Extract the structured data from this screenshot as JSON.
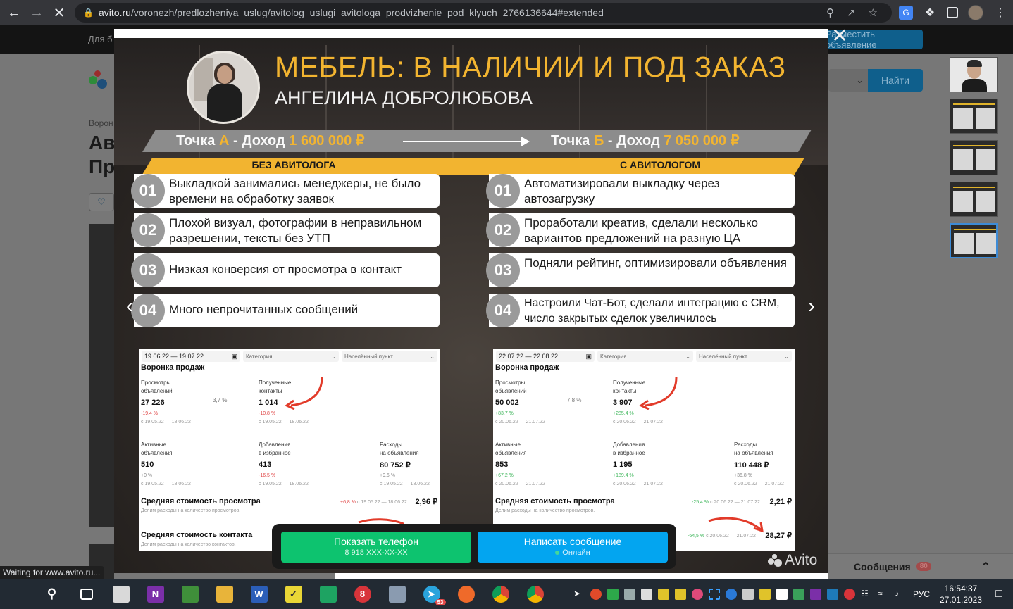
{
  "browser": {
    "url_host": "avito.ru",
    "url_path": "/voronezh/predlozheniya_uslug/avitolog_uslugi_avitologa_prodvizhenie_pod_klyuch_2766136644#extended",
    "status_text": "Waiting for www.avito.ru..."
  },
  "page_bg": {
    "topbar_hint": "Для б",
    "post_ad_label": "Разместить объявление",
    "find_label": "Найти",
    "breadcrumb": "Ворон",
    "title_line1": "Ав",
    "title_line2": "Пр",
    "messages_label": "Сообщения",
    "messages_count": "80"
  },
  "slide": {
    "headline": "МЕБЕЛЬ: В НАЛИЧИИ И ПОД ЗАКАЗ",
    "author": "АНГЕЛИНА ДОБРОЛЮБОВА",
    "point_a_label": "Точка",
    "point_a_letter": "А",
    "point_a_sep": "-  Доход",
    "point_a_income": "1 600 000 ₽",
    "point_b_label": "Точка",
    "point_b_letter": "Б",
    "point_b_sep": "-  Доход",
    "point_b_income": "7 050 000 ₽",
    "col_left_title": "БЕЗ АВИТОЛОГА",
    "col_right_title": "С АВИТОЛОГОМ",
    "left_items": [
      {
        "num": "01",
        "text": "Выкладкой занимались менеджеры, не было времени на обработку заявок"
      },
      {
        "num": "02",
        "text": "Плохой визуал, фотографии в неправильном разрешении, тексты без УТП"
      },
      {
        "num": "03",
        "text": "Низкая конверсия от просмотра в контакт"
      },
      {
        "num": "04",
        "text": "Много непрочитанных сообщений"
      }
    ],
    "right_items": [
      {
        "num": "01",
        "text": "Автоматизировали выкладку через автозагрузку"
      },
      {
        "num": "02",
        "text": "Проработали креатив, сделали несколько вариантов предложений на разную ЦА"
      },
      {
        "num": "03",
        "text": "Подняли рейтинг, оптимизировали объявления"
      },
      {
        "num": "04",
        "text": "Настроили Чат-Бот, сделали интеграцию с CRM, число закрытых сделок увеличилось"
      }
    ],
    "dash_left": {
      "date": "19.06.22 — 19.07.22",
      "category": "Категория",
      "location": "Населённый пункт",
      "title": "Воронка продаж",
      "views_label1": "Просмотры",
      "views_label2": "объявлений",
      "views": "27 226",
      "views_pct": "-19,4 %",
      "views_period": "с 19.05.22 — 18.06.22",
      "conv": "3,7 %",
      "contacts_label1": "Полученные",
      "contacts_label2": "контакты",
      "contacts": "1 014",
      "contacts_pct": "-10,8 %",
      "contacts_period": "с 19.05.22 — 18.06.22",
      "active_label1": "Активные",
      "active_label2": "объявления",
      "active": "510",
      "active_pct": "+0 %",
      "active_period": "с 19.05.22 — 18.06.22",
      "fav_label1": "Добавления",
      "fav_label2": "в избранное",
      "fav": "413",
      "fav_pct": "-16,5 %",
      "fav_period": "с 19.05.22 — 18.06.22",
      "spend_label1": "Расходы",
      "spend_label2": "на объявления",
      "spend": "80 752 ₽",
      "spend_pct": "+9,6 %",
      "spend_period": "с 19.05.22 — 18.06.22",
      "cpv_title": "Средняя стоимость просмотра",
      "cpv_sub": "Делим расходы на количество просмотров.",
      "cpv_pct": "+6,8 %",
      "cpv_period": "с 19.05.22 — 18.06.22",
      "cpv": "2,96 ₽",
      "cpc_title": "Средняя стоимость контакта",
      "cpc_sub": "Делим расходы на количество контактов."
    },
    "dash_right": {
      "date": "22.07.22 — 22.08.22",
      "category": "Категория",
      "location": "Населённый пункт",
      "title": "Воронка продаж",
      "views_label1": "Просмотры",
      "views_label2": "объявлений",
      "views": "50 002",
      "views_pct": "+83,7 %",
      "views_period": "с 20.06.22 — 21.07.22",
      "conv": "7,8 %",
      "contacts_label1": "Полученные",
      "contacts_label2": "контакты",
      "contacts": "3 907",
      "contacts_pct": "+285,4 %",
      "contacts_period": "с 20.06.22 — 21.07.22",
      "active_label1": "Активные",
      "active_label2": "объявления",
      "active": "853",
      "active_pct": "+67,2 %",
      "active_period": "с 20.06.22 — 21.07.22",
      "fav_label1": "Добавления",
      "fav_label2": "в избранное",
      "fav": "1 195",
      "fav_pct": "+189,4 %",
      "fav_period": "с 20.06.22 — 21.07.22",
      "spend_label1": "Расходы",
      "spend_label2": "на объявления",
      "spend": "110 448 ₽",
      "spend_pct": "+36,8 %",
      "spend_period": "с 20.06.22 — 21.07.22",
      "cpv_title": "Средняя стоимость просмотра",
      "cpv_sub": "Делим расходы на количество просмотров.",
      "cpv_pct": "-25,4 %",
      "cpv_period": "с 20.06.22 — 21.07.22",
      "cpv": "2,21 ₽",
      "cpc_pct": "-64,5 %",
      "cpc_period": "с 20.06.22 — 21.07.22",
      "cpc": "28,27 ₽"
    },
    "cta_phone_label": "Показать телефон",
    "cta_phone_number": "8 918 XXX-XX-XX",
    "cta_message_label": "Написать сообщение",
    "cta_online": "Онлайн",
    "watermark": "Avito"
  },
  "taskbar": {
    "lang": "РУС",
    "time": "16:54:37",
    "date": "27.01.2023",
    "telegram_badge": "53"
  },
  "colors": {
    "accent_yellow": "#f2b430",
    "cta_green": "#0dc36f",
    "cta_blue": "#03a5f0"
  }
}
